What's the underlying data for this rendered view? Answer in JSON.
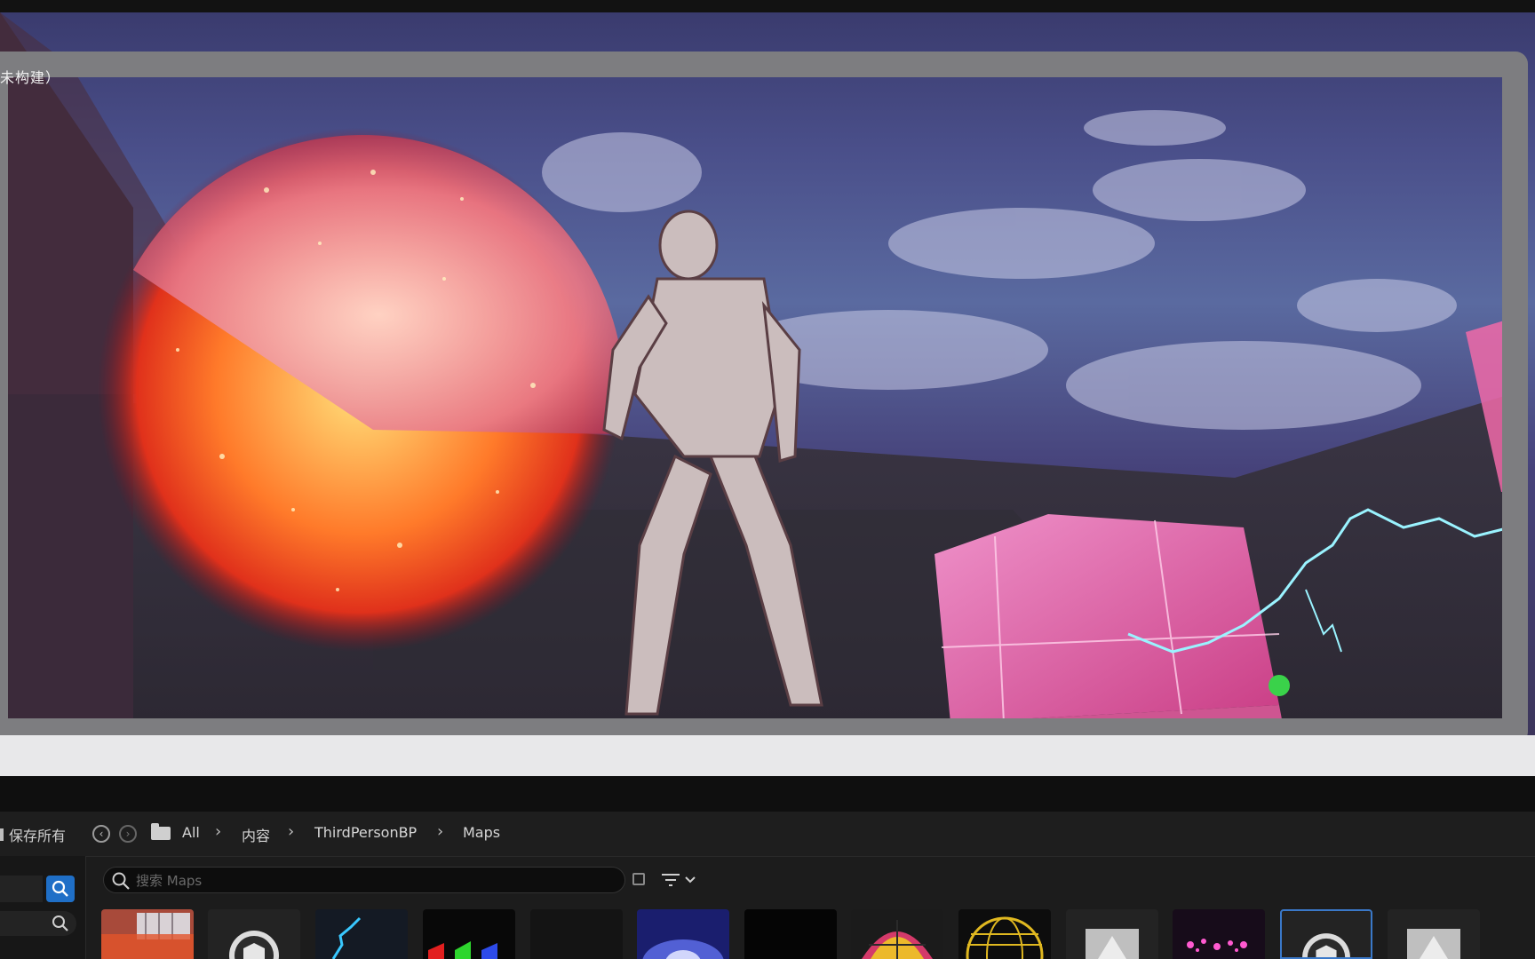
{
  "viewport": {
    "build_status": "未构建）"
  },
  "content_browser": {
    "save_all_label": "保存所有",
    "breadcrumb": [
      "All",
      "内容",
      "ThirdPersonBP",
      "Maps"
    ],
    "search_placeholder": "搜索 Maps"
  },
  "assets": [
    {
      "icon": "level-thumbnail"
    },
    {
      "icon": "static-mesh-sphere"
    },
    {
      "icon": "lightning-material"
    },
    {
      "icon": "rgb-arrows-texture"
    },
    {
      "icon": "dark-material"
    },
    {
      "icon": "blue-glow-material"
    },
    {
      "icon": "black-material"
    },
    {
      "icon": "geodesic-dome-mesh"
    },
    {
      "icon": "grid-sphere-mesh"
    },
    {
      "icon": "texture-placeholder"
    },
    {
      "icon": "pink-particle-material"
    },
    {
      "icon": "static-mesh-sphere-selected"
    },
    {
      "icon": "texture-placeholder"
    }
  ],
  "colors": {
    "accent": "#1f6fc7",
    "frame": "#7d7d80",
    "panel": "#1c1c1c"
  }
}
